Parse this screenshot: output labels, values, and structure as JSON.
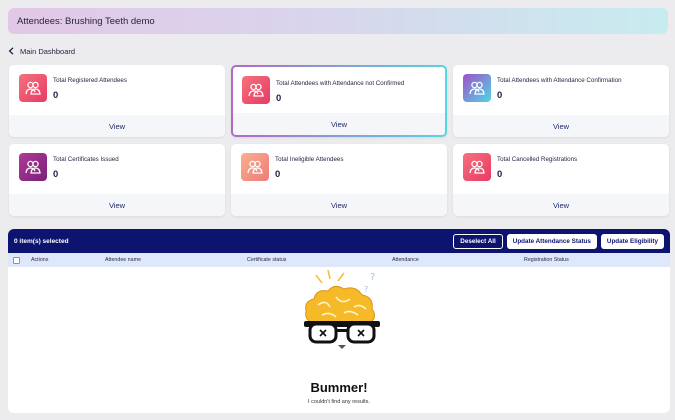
{
  "header": {
    "title": "Attendees: Brushing Teeth demo"
  },
  "nav": {
    "back_label": "Main Dashboard"
  },
  "cards": [
    {
      "title": "Total Registered Attendees",
      "count": "0",
      "action": "View",
      "color": "#f0566f"
    },
    {
      "title": "Total Attendees with Attendance not Confirmed",
      "count": "0",
      "action": "View",
      "color": "#f0566f"
    },
    {
      "title": "Total Attendees with Attendance Confirmation",
      "count": "0",
      "action": "View",
      "color": "#5fb9e6"
    },
    {
      "title": "Total Certificates Issued",
      "count": "0",
      "action": "View",
      "color": "#9b2f8c"
    },
    {
      "title": "Total Ineligible Attendees",
      "count": "0",
      "action": "View",
      "color": "#f79a83"
    },
    {
      "title": "Total Cancelled Registrations",
      "count": "0",
      "action": "View",
      "color": "#f0566f"
    }
  ],
  "table": {
    "selected_text": "0 item(s) selected",
    "buttons": {
      "deselect": "Deselect All",
      "update_attendance": "Update Attendance Status",
      "update_eligibility": "Update Eligibility"
    },
    "columns": [
      "Actions",
      "Attendee name",
      "Certificate status",
      "Attendance",
      "Registration Status"
    ]
  },
  "empty_state": {
    "title": "Bummer!",
    "message": "I couldn't find any results."
  }
}
